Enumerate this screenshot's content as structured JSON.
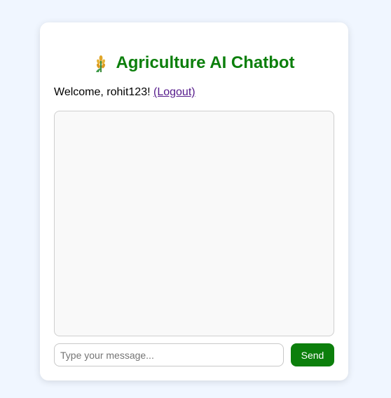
{
  "header": {
    "icon": "wheat-icon",
    "title": "Agriculture AI Chatbot",
    "title_color": "#0c7f0c"
  },
  "user": {
    "welcome_text": "Welcome, rohit123! ",
    "logout_label": "(Logout)"
  },
  "chat": {
    "messages": []
  },
  "composer": {
    "placeholder": "Type your message...",
    "value": "",
    "send_label": "Send",
    "send_color": "#0c7f0c"
  }
}
